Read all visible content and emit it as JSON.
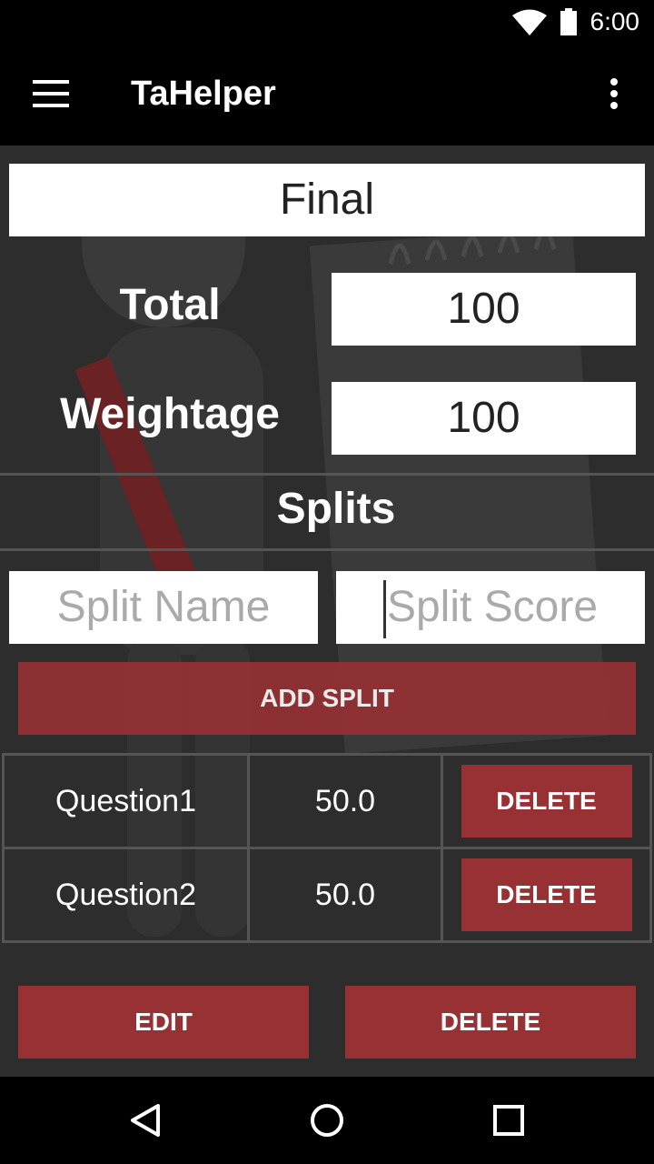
{
  "status_bar": {
    "time": "6:00"
  },
  "app_bar": {
    "title": "TaHelper"
  },
  "form": {
    "exam_name": "Final",
    "total_label": "Total",
    "total_value": "100",
    "weightage_label": "Weightage",
    "weightage_value": "100",
    "splits_heading": "Splits",
    "split_name_placeholder": "Split Name",
    "split_score_placeholder": "Split Score",
    "add_split_label": "ADD SPLIT"
  },
  "splits": [
    {
      "name": "Question1",
      "score": "50.0",
      "delete_label": "DELETE"
    },
    {
      "name": "Question2",
      "score": "50.0",
      "delete_label": "DELETE"
    }
  ],
  "footer": {
    "edit_label": "EDIT",
    "delete_label": "DELETE"
  },
  "colors": {
    "accent": "#973134",
    "background": "#2d2d2d",
    "bar": "#000000"
  }
}
